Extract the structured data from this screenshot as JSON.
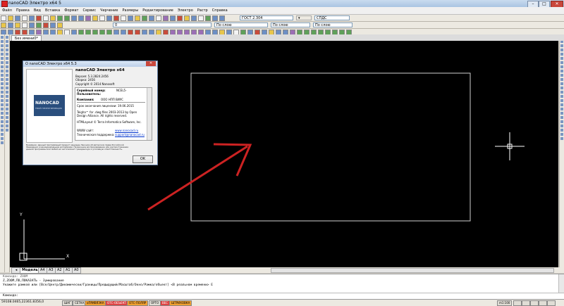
{
  "window": {
    "title": "nanoCAD Электро x64 5"
  },
  "menu": [
    "Файл",
    "Правка",
    "Вид",
    "Вставка",
    "Формат",
    "Сервис",
    "Черчение",
    "Размеры",
    "Редактирование",
    "Электро",
    "Растр",
    "Справка"
  ],
  "toolbar": {
    "standard_combo": "ГОСТ 2.304",
    "dim_combo": "СПДС",
    "layer_combo": "0",
    "color_combo": "По слою",
    "linetype_combo": "По слою",
    "lineweight_combo": "По слою"
  },
  "document": {
    "tab_label": "Без имени0*"
  },
  "about_dialog": {
    "title": "О nanoCAD Электро x64 5.3",
    "close": "✕",
    "logo_text": "NANOCAD",
    "logo_sub": "ТВОЙ ПРОЕКТИРОВЩИК",
    "product": "nanoCAD Электро x64",
    "version": "Версия: 5.3.2824.2456",
    "build": "Сборка: 2456",
    "copyright": "Copyright © 2014 Nanosoft",
    "serial_label": "Серийный номер:",
    "serial_value": "NCEL5-",
    "user_label": "Пользователь:",
    "user_value": "",
    "company_label": "Компания:",
    "company_value": "ООО НПП ВИУС",
    "license_line": "Срок окончания лицензии: 19.06.2015",
    "teigha_1": "Teigha™ for .dwg files 2003-2013 by Open",
    "teigha_2": "Design Alliance. All rights reserved.",
    "htmlayout": "HTMLayout © Terra Informatica Software, Inc.",
    "www_label": "WWW сайт:",
    "www_value": "www.nanocad.ru",
    "support_label": "Техническая поддержка:",
    "support_value": "support@nanocad.ru",
    "notice": "Внимание: данный программный продукт защищен Законом об авторском праве Российской Федерации и международными договорами. Незаконное воспроизведение или распространение данной программы или любой ее части влечет гражданскую и уголовную ответственность.",
    "ok": "OK"
  },
  "layout_tabs": [
    "Модель",
    "A4",
    "A3",
    "A2",
    "A1",
    "A0"
  ],
  "command": {
    "history": [
      "Команда: ZOOM",
      "Z,ZOOM,ПО,ПОКАЗАТЬ - Зумирование",
      "Укажите рамкой или [Все/Центр/Динамически/Границы/Предыдущий/Масштаб/Окно/Рамка/объект] <В реальном времени> Е"
    ],
    "prompt": "Команда:"
  },
  "ucs": {
    "y_label": "Y",
    "x_label": "X"
  },
  "status": {
    "coords": "59108.0465,22361.8356,0",
    "buttons": [
      "ШАГ",
      "СЕТКА",
      "оПРИВЯЗКА",
      "ОТС-ОБЪЕКТ",
      "ОТС-ПОЛЯР",
      "ОРТО",
      "ВЕС",
      "ШТРИХОВКА"
    ],
    "scale": "m1:100"
  },
  "colors": {
    "accent_arrow": "#cc2222",
    "canvas": "#000000",
    "frame": "#d0d0d0"
  }
}
